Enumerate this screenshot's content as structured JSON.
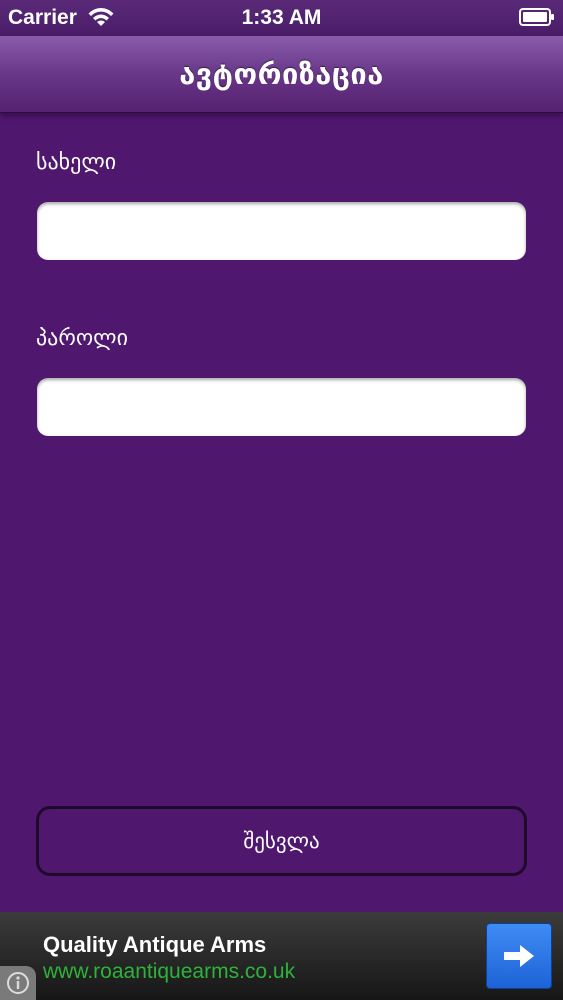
{
  "status_bar": {
    "carrier": "Carrier",
    "time": "1:33 AM"
  },
  "nav": {
    "title": "ავტორიზაცია"
  },
  "form": {
    "username_label": "სახელი",
    "username_value": "",
    "password_label": "პაროლი",
    "password_value": "",
    "login_label": "შესვლა"
  },
  "ad": {
    "title": "Quality Antique Arms",
    "url": "www.roaantiquearms.co.uk",
    "icons": [
      "arrow-right-icon",
      "info-icon"
    ]
  },
  "colors": {
    "background": "#50176f",
    "nav_top": "#8a5cab",
    "ad_url": "#2db33a",
    "ad_button": "#2a74e6"
  }
}
